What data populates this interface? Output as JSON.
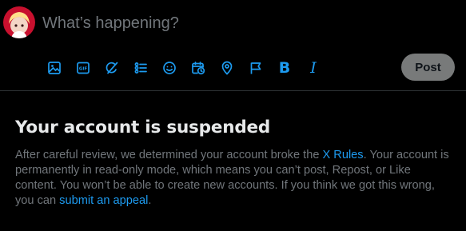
{
  "composer": {
    "placeholder": "What’s happening?",
    "post_label": "Post",
    "toolbar_icons": [
      "image-icon",
      "gif-icon",
      "grok-icon",
      "poll-icon",
      "emoji-icon",
      "schedule-icon",
      "location-icon",
      "flag-icon",
      "bold-icon",
      "italic-icon"
    ],
    "gif_label": "GIF",
    "bold_label": "B",
    "italic_label": "I"
  },
  "notice": {
    "title": "Your account is suspended",
    "body_part1": "After careful review, we determined your account broke the ",
    "rules_link": "X Rules",
    "body_part2": ". Your account is permanently in read-only mode, which means you can’t post, Repost, or Like content. You won’t be able to create new accounts. If you think we got this wrong, you can ",
    "appeal_link": "submit an appeal",
    "body_part3": "."
  },
  "colors": {
    "background": "#000000",
    "accent": "#1d9bf0",
    "text_primary": "#e7e9ea",
    "text_secondary": "#71767b",
    "post_button_bg": "#787a7a",
    "divider": "#2f3336"
  }
}
